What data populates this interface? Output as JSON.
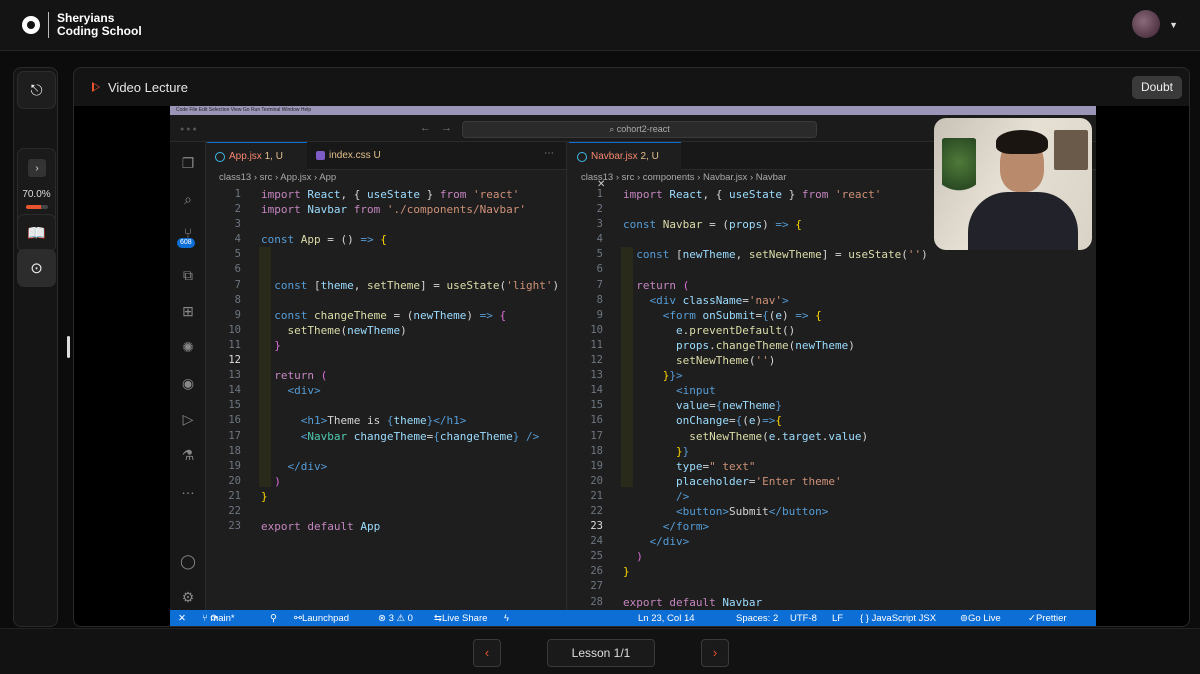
{
  "brand": {
    "line1": "Sheryians",
    "line2": "Coding School"
  },
  "rail": {
    "progress_text": "70.0%",
    "progress_value": 0.7,
    "chevron": "›"
  },
  "header": {
    "title": "Video Lecture",
    "doubt_label": "Doubt"
  },
  "footer": {
    "prev": "‹",
    "next": "›",
    "lesson": "Lesson 1/1"
  },
  "ide": {
    "mac_menu": "Code  File  Edit  Selection  View  Go  Run  Terminal  Window  Help",
    "command_center": "cohort2-react",
    "activity_badge": "608",
    "left": {
      "tab1": {
        "name": "App.jsx",
        "status": "1, U"
      },
      "tab2": {
        "name": "index.css",
        "status": "U"
      },
      "breadcrumb": "class13 › src › App.jsx › App"
    },
    "right": {
      "tab1": {
        "name": "Navbar.jsx",
        "status": "2, U"
      },
      "breadcrumb": "class13 › src › components › Navbar.jsx › Navbar"
    },
    "status": {
      "branch": "main*",
      "launchpad": "Launchpad",
      "errors": "⊗ 3 ⚠ 0",
      "liveshare": "Live Share",
      "position": "Ln 23, Col 14",
      "spaces": "Spaces: 2",
      "encoding": "UTF-8",
      "eol": "LF",
      "language": "{ } JavaScript JSX",
      "golive": "Go Live",
      "prettier": "Prettier"
    }
  }
}
